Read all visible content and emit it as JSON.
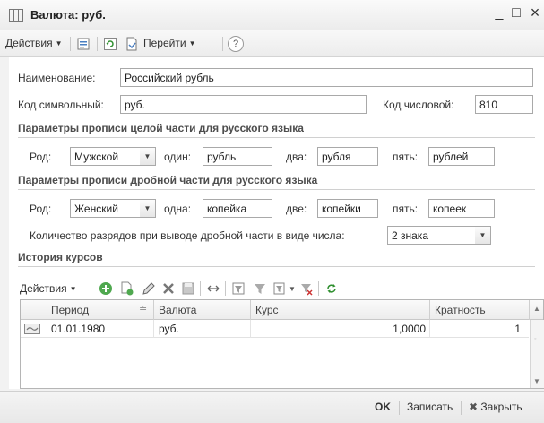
{
  "window": {
    "title": "Валюта: руб.",
    "minimize": "_",
    "maximize": "□",
    "close": "×"
  },
  "toolbar": {
    "actions_label": "Действия",
    "goto_label": "Перейти",
    "help_label": "?"
  },
  "form": {
    "name_label": "Наименование:",
    "name_value": "Российский рубль",
    "symbol_code_label": "Код символьный:",
    "symbol_code_value": "руб.",
    "numeric_code_label": "Код числовой:",
    "numeric_code_value": "810",
    "integer_section_title": "Параметры прописи целой части для русского языка",
    "integer": {
      "gender_label": "Род:",
      "gender_value": "Мужской",
      "one_label": "один:",
      "one_value": "рубль",
      "two_label": "два:",
      "two_value": "рубля",
      "five_label": "пять:",
      "five_value": "рублей"
    },
    "fraction_section_title": "Параметры прописи дробной части для русского языка",
    "fraction": {
      "gender_label": "Род:",
      "gender_value": "Женский",
      "one_label": "одна:",
      "one_value": "копейка",
      "two_label": "две:",
      "two_value": "копейки",
      "five_label": "пять:",
      "five_value": "копеек"
    },
    "digits_label": "Количество разрядов при выводе дробной части в виде числа:",
    "digits_value": "2 знака",
    "history_title": "История курсов"
  },
  "history_toolbar": {
    "actions_label": "Действия"
  },
  "history_grid": {
    "columns": [
      "Период",
      "Валюта",
      "Курс",
      "Кратность"
    ],
    "rows": [
      {
        "period": "01.01.1980",
        "currency": "руб.",
        "rate": "1,0000",
        "multiplicity": "1"
      }
    ]
  },
  "footer": {
    "ok_label": "OK",
    "save_label": "Записать",
    "close_label": "Закрыть"
  }
}
